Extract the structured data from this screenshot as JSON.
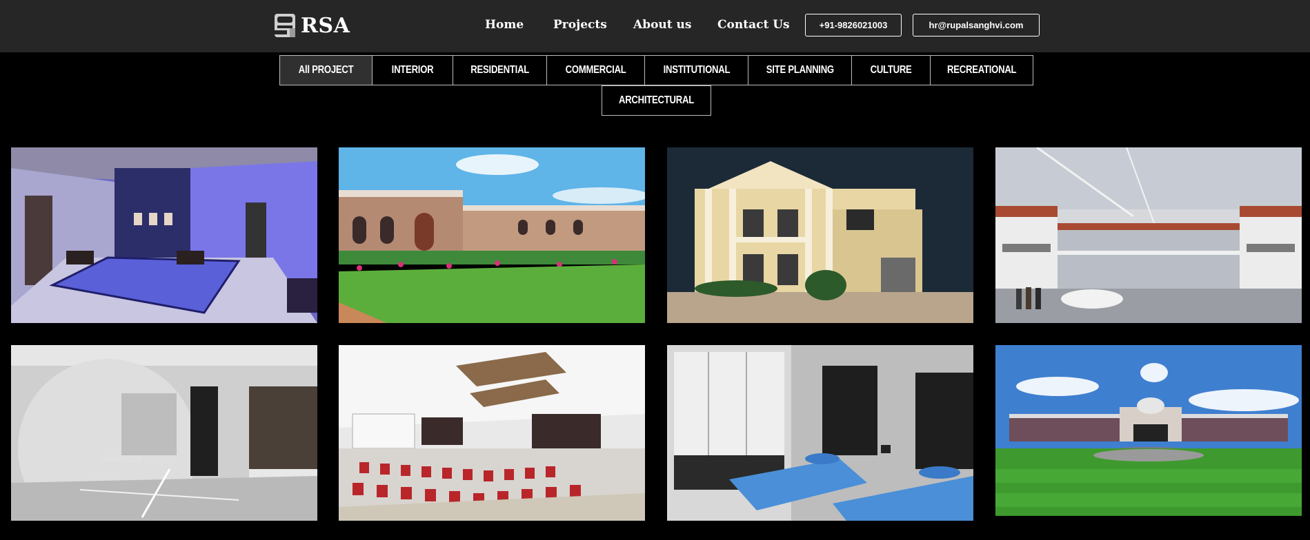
{
  "brand": {
    "name": "RSA",
    "logo_icon": "rsa-logo-icon"
  },
  "nav": {
    "items": [
      {
        "label": "Home"
      },
      {
        "label": "Projects"
      },
      {
        "label": "About us"
      },
      {
        "label": "Contact Us"
      }
    ]
  },
  "contact": {
    "phone": "+91-9826021003",
    "email": "hr@rupalsanghvi.com"
  },
  "filters": {
    "active": "All PROJECT",
    "items": [
      {
        "label": "All PROJECT"
      },
      {
        "label": "INTERIOR"
      },
      {
        "label": "RESIDENTIAL"
      },
      {
        "label": "COMMERCIAL"
      },
      {
        "label": "INSTITUTIONAL"
      },
      {
        "label": "SITE PLANNING"
      },
      {
        "label": "CULTURE"
      },
      {
        "label": "RECREATIONAL"
      },
      {
        "label": "ARCHITECTURAL"
      }
    ]
  },
  "gallery": {
    "items": [
      {
        "subject": "interior-conference-room-blue-lighting"
      },
      {
        "subject": "exterior-heritage-building-garden"
      },
      {
        "subject": "exterior-residential-villa"
      },
      {
        "subject": "exterior-commercial-complex"
      },
      {
        "subject": "interior-white-lounge"
      },
      {
        "subject": "interior-auditorium-red-seats"
      },
      {
        "subject": "interior-bedroom-twin-beds"
      },
      {
        "subject": "exterior-institutional-campus-lawn"
      }
    ]
  },
  "colors": {
    "header_bg": "#262626",
    "page_bg": "#000000",
    "active_tab_bg": "#303030"
  }
}
